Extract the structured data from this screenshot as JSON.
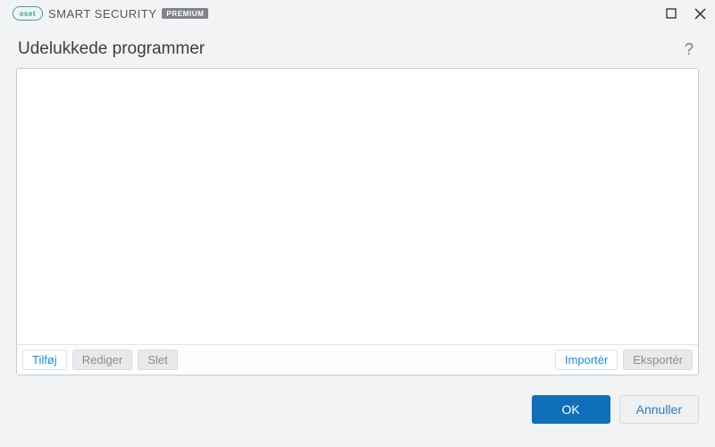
{
  "titlebar": {
    "logo_text": "eset",
    "product_name": "SMART SECURITY",
    "badge": "PREMIUM"
  },
  "header": {
    "title": "Udelukkede programmer",
    "help_symbol": "?"
  },
  "toolbar": {
    "add": "Tilføj",
    "edit": "Rediger",
    "delete": "Slet",
    "import": "Importér",
    "export": "Eksportér"
  },
  "footer": {
    "ok": "OK",
    "cancel": "Annuller"
  }
}
